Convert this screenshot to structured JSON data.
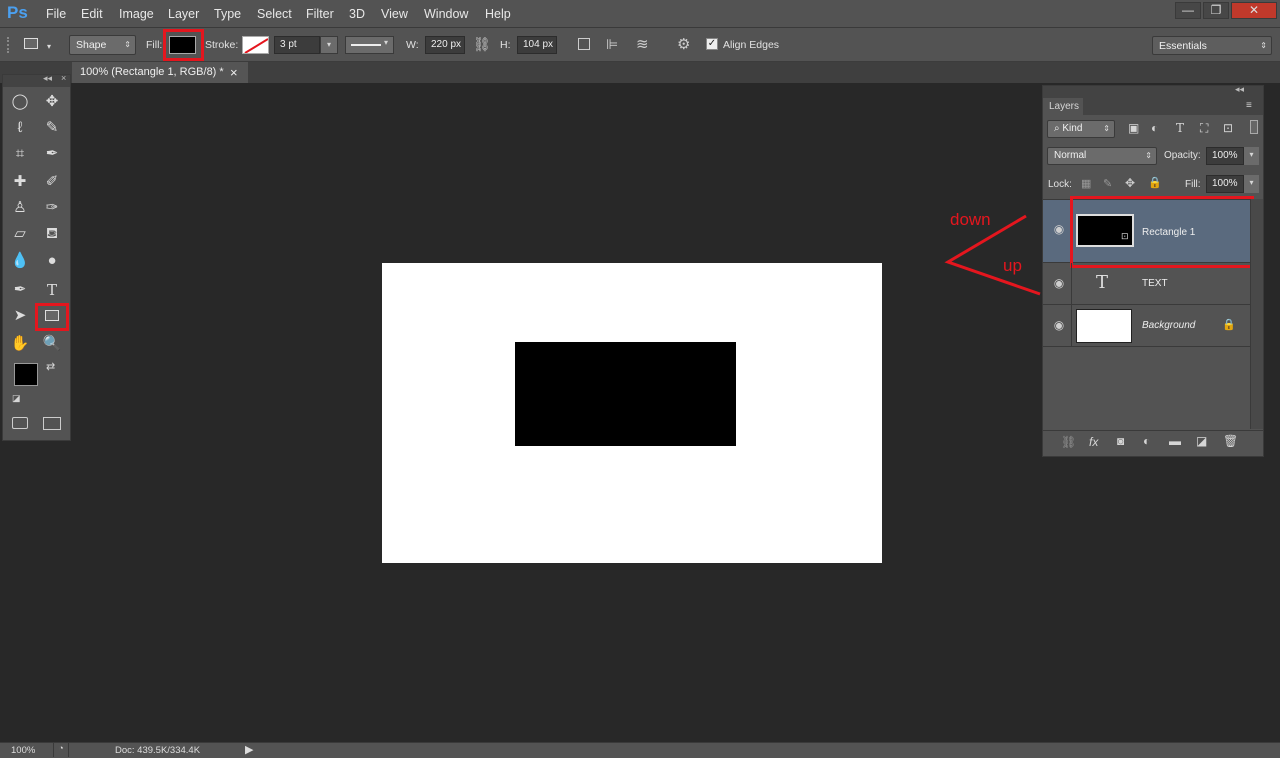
{
  "app": {
    "logo": "Ps"
  },
  "menu": [
    "File",
    "Edit",
    "Image",
    "Layer",
    "Type",
    "Select",
    "Filter",
    "3D",
    "View",
    "Window",
    "Help"
  ],
  "window_controls": {
    "minimize": "—",
    "restore": "❐",
    "close": "✕"
  },
  "options": {
    "mode": "Shape",
    "fill_label": "Fill:",
    "stroke_label": "Stroke:",
    "stroke_width": "3 pt",
    "w_label": "W:",
    "w_value": "220 px",
    "h_label": "H:",
    "h_value": "104 px",
    "align_edges": "Align Edges",
    "workspace": "Essentials"
  },
  "document_tab": {
    "title": "100% (Rectangle 1, RGB/8) *",
    "close": "×"
  },
  "layers_panel": {
    "title": "Layers",
    "kind": "Kind",
    "blend_mode": "Normal",
    "opacity_label": "Opacity:",
    "opacity_value": "100%",
    "lock_label": "Lock:",
    "fill_label": "Fill:",
    "fill_value": "100%",
    "layers": [
      {
        "name": "Rectangle 1",
        "selected": true
      },
      {
        "name": "TEXT",
        "selected": false
      },
      {
        "name": "Background",
        "selected": false
      }
    ]
  },
  "annotations": {
    "down": "down",
    "up": "up"
  },
  "status": {
    "zoom": "100%",
    "doc": "Doc: 439.5K/334.4K"
  },
  "colors": {
    "accent_red": "#e4161e",
    "selected_layer": "#5a6a7e",
    "panel_bg": "#535353",
    "workspace_bg": "#282828"
  }
}
